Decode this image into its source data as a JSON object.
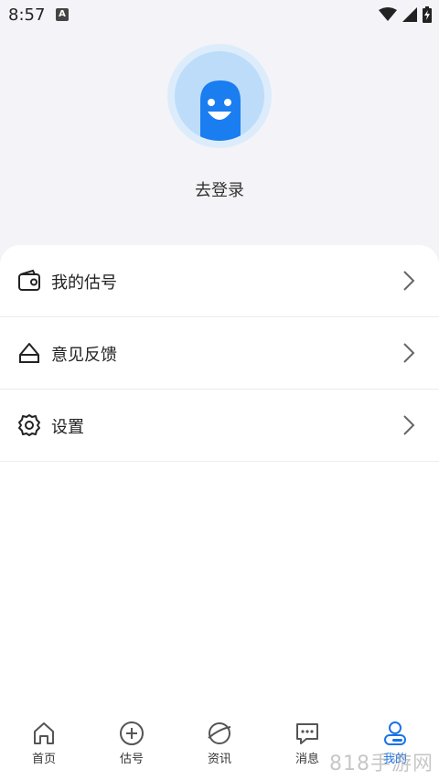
{
  "status_bar": {
    "time": "8:57",
    "a_badge": "A"
  },
  "profile": {
    "login_label": "去登录"
  },
  "menu": [
    {
      "label": "我的估号",
      "icon": "wallet-icon"
    },
    {
      "label": "意见反馈",
      "icon": "feedback-icon"
    },
    {
      "label": "设置",
      "icon": "gear-icon"
    }
  ],
  "tabs": [
    {
      "label": "首页",
      "icon": "home-icon",
      "active": false
    },
    {
      "label": "估号",
      "icon": "plus-circle-icon",
      "active": false
    },
    {
      "label": "资讯",
      "icon": "planet-icon",
      "active": false
    },
    {
      "label": "消息",
      "icon": "chat-icon",
      "active": false
    },
    {
      "label": "我的",
      "icon": "user-icon",
      "active": true
    }
  ],
  "watermark": {
    "text": "818手游网"
  },
  "colors": {
    "accent": "#1a73e8",
    "avatar_blue": "#1a7df0"
  }
}
